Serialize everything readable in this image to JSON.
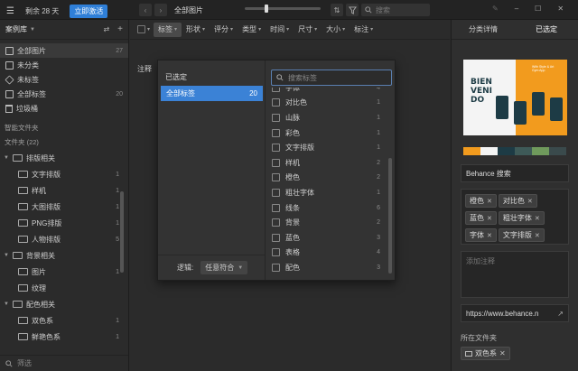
{
  "titlebar": {
    "trial_text": "剩余 28 天",
    "activate_label": "立即激活",
    "page_title": "全部图片",
    "search_placeholder": "搜索"
  },
  "sidebar": {
    "library_label": "案例库",
    "items": [
      {
        "label": "全部图片",
        "count": "27",
        "icon": "images-icon"
      },
      {
        "label": "未分类",
        "count": "",
        "icon": "unclassified-icon"
      },
      {
        "label": "未标签",
        "count": "",
        "icon": "untagged-icon"
      },
      {
        "label": "全部标签",
        "count": "20",
        "icon": "tags-icon"
      },
      {
        "label": "垃圾桶",
        "count": "",
        "icon": "trash-icon"
      }
    ],
    "smart_folder_label": "智能文件夹",
    "folders_label": "文件夹 (22)",
    "folder_tree": [
      {
        "label": "排版相关",
        "count": "",
        "depth": 0
      },
      {
        "label": "文字排版",
        "count": "1",
        "depth": 1
      },
      {
        "label": "样机",
        "count": "1",
        "depth": 1
      },
      {
        "label": "大图排版",
        "count": "1",
        "depth": 1
      },
      {
        "label": "PNG排版",
        "count": "1",
        "depth": 1
      },
      {
        "label": "人物排版",
        "count": "5",
        "depth": 1
      },
      {
        "label": "背景相关",
        "count": "",
        "depth": 0
      },
      {
        "label": "图片",
        "count": "1",
        "depth": 1
      },
      {
        "label": "纹理",
        "count": "",
        "depth": 1
      },
      {
        "label": "配色相关",
        "count": "",
        "depth": 0
      },
      {
        "label": "双色系",
        "count": "1",
        "depth": 1
      },
      {
        "label": "鲜艳色系",
        "count": "1",
        "depth": 1
      }
    ],
    "filter_placeholder": "筛选"
  },
  "filters": {
    "labels": [
      "标签",
      "形状",
      "评分",
      "类型",
      "时间",
      "尺寸",
      "大小",
      "标注"
    ],
    "note_label": "注释"
  },
  "dropdown": {
    "selected_header": "已选定",
    "all_tags_label": "全部标签",
    "all_tags_count": "20",
    "logic_label": "逻辑:",
    "logic_value": "任意符合",
    "search_placeholder": "搜索标签",
    "tags": [
      {
        "label": "字体",
        "count": "4"
      },
      {
        "label": "对比色",
        "count": "1"
      },
      {
        "label": "山脉",
        "count": "1"
      },
      {
        "label": "彩色",
        "count": "1"
      },
      {
        "label": "文字排版",
        "count": "1"
      },
      {
        "label": "样机",
        "count": "2"
      },
      {
        "label": "橙色",
        "count": "2"
      },
      {
        "label": "粗壮字体",
        "count": "1"
      },
      {
        "label": "线条",
        "count": "6"
      },
      {
        "label": "背景",
        "count": "2"
      },
      {
        "label": "蓝色",
        "count": "3"
      },
      {
        "label": "表格",
        "count": "4"
      },
      {
        "label": "配色",
        "count": "3"
      }
    ]
  },
  "right_panel": {
    "tab_details": "分类详情",
    "tab_selected": "已选定",
    "palette": [
      "#f29b1e",
      "#f4f4f4",
      "#1d3b45",
      "#3e5a58",
      "#6f9a5c",
      "#3a4a4c"
    ],
    "preview_text": "BIEN VENI DO",
    "preview_small": "With Style & Art\nGym App",
    "title_value": "Behance  搜索",
    "tags": [
      "橙色",
      "对比色",
      "蓝色",
      "粗壮字体",
      "字体",
      "文字排版"
    ],
    "note_placeholder": "添加注释",
    "url_value": "https://www.behance.n",
    "folder_section_label": "所在文件夹",
    "folder_chip": "双色系"
  }
}
